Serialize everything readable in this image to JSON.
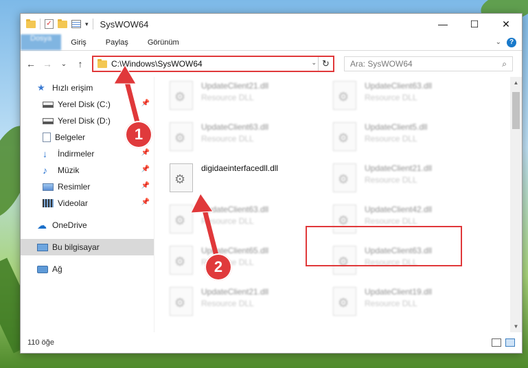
{
  "window": {
    "title": "SysWOW64",
    "controls": {
      "minimize": "—",
      "maximize": "☐",
      "close": "✕"
    }
  },
  "ribbon": {
    "tabs": [
      "Dosya",
      "Giriş",
      "Paylaş",
      "Görünüm"
    ],
    "help": "?"
  },
  "navigation": {
    "back": "←",
    "forward": "→",
    "recent": "⌄",
    "up": "↑",
    "address": "C:\\Windows\\SysWOW64",
    "refresh": "↻",
    "search_placeholder": "Ara: SysWOW64"
  },
  "sidebar": {
    "items": [
      {
        "label": "Hızlı erişim",
        "icon": "star-icon",
        "pinned": false,
        "selected": false
      },
      {
        "label": "Yerel Disk (C:)",
        "icon": "drive-icon",
        "pinned": true,
        "selected": false
      },
      {
        "label": "Yerel Disk (D:)",
        "icon": "drive-icon",
        "pinned": true,
        "selected": false
      },
      {
        "label": "Belgeler",
        "icon": "documents-icon",
        "pinned": true,
        "selected": false
      },
      {
        "label": "İndirmeler",
        "icon": "downloads-icon",
        "pinned": true,
        "selected": false
      },
      {
        "label": "Müzik",
        "icon": "music-icon",
        "pinned": true,
        "selected": false
      },
      {
        "label": "Resimler",
        "icon": "pictures-icon",
        "pinned": true,
        "selected": false
      },
      {
        "label": "Videolar",
        "icon": "videos-icon",
        "pinned": true,
        "selected": false
      },
      {
        "label": "OneDrive",
        "icon": "onedrive-icon",
        "pinned": false,
        "selected": false
      },
      {
        "label": "Bu bilgisayar",
        "icon": "computer-icon",
        "pinned": false,
        "selected": true
      },
      {
        "label": "Ağ",
        "icon": "network-icon",
        "pinned": false,
        "selected": false
      }
    ]
  },
  "files": [
    {
      "name": "UpdateClient21.dll",
      "desc": "Resource DLL",
      "highlighted": false
    },
    {
      "name": "UpdateClient63.dll",
      "desc": "Resource DLL",
      "highlighted": false
    },
    {
      "name": "UpdateClient63.dll",
      "desc": "Resource DLL",
      "highlighted": false
    },
    {
      "name": "UpdateClient5.dll",
      "desc": "Resource DLL",
      "highlighted": false
    },
    {
      "name": "digidaeinterfacedll.dll",
      "desc": "",
      "highlighted": true
    },
    {
      "name": "UpdateClient21.dll",
      "desc": "Resource DLL",
      "highlighted": false
    },
    {
      "name": "UpdateClient63.dll",
      "desc": "Resource DLL",
      "highlighted": false
    },
    {
      "name": "UpdateClient42.dll",
      "desc": "Resource DLL",
      "highlighted": false
    },
    {
      "name": "UpdateClient65.dll",
      "desc": "Resource DLL",
      "highlighted": false
    },
    {
      "name": "UpdateClient63.dll",
      "desc": "Resource DLL",
      "highlighted": false
    },
    {
      "name": "UpdateClient21.dll",
      "desc": "Resource DLL",
      "highlighted": false
    },
    {
      "name": "UpdateClient19.dll",
      "desc": "Resource DLL",
      "highlighted": false
    }
  ],
  "status": {
    "count": "110 öğe"
  },
  "annotations": {
    "step1": "1",
    "step2": "2"
  },
  "colors": {
    "accent": "#1979ca",
    "annotation": "#e0383a",
    "selection": "#d9d9d9"
  }
}
